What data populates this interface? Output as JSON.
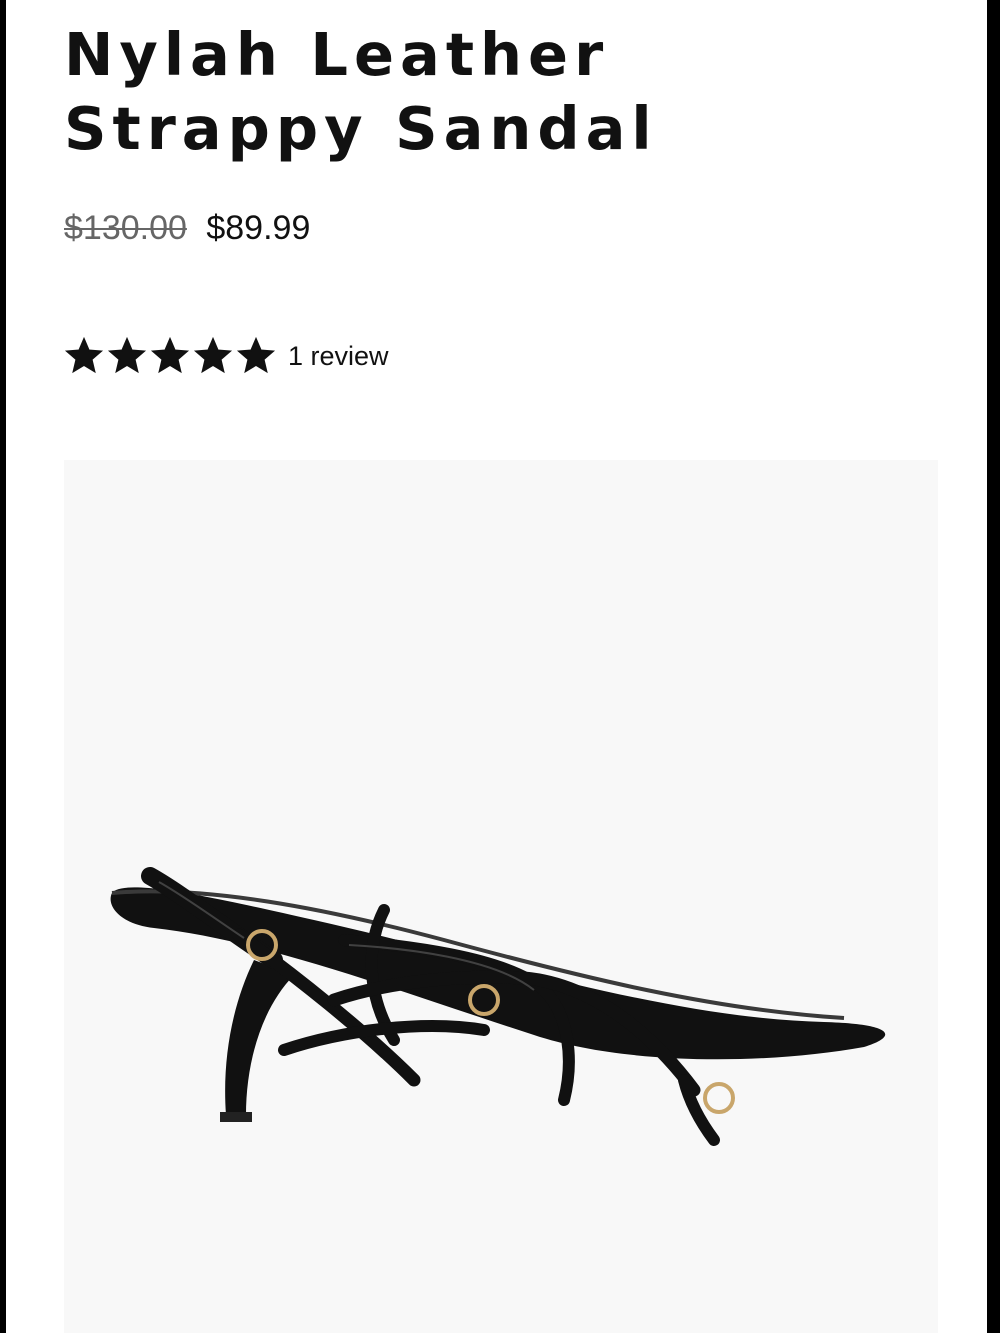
{
  "product": {
    "title_line1": "Nylah Leather",
    "title_line2": "Strappy Sandal",
    "price_original": "$130.00",
    "price_sale": "$89.99",
    "rating": 5,
    "rating_max": 5,
    "review_text": "1 review",
    "image_icon": "sandal-product-image"
  },
  "colors": {
    "text": "#111111",
    "strikethrough": "#666666",
    "image_background": "#f8f8f8",
    "frame_border": "#000000"
  }
}
